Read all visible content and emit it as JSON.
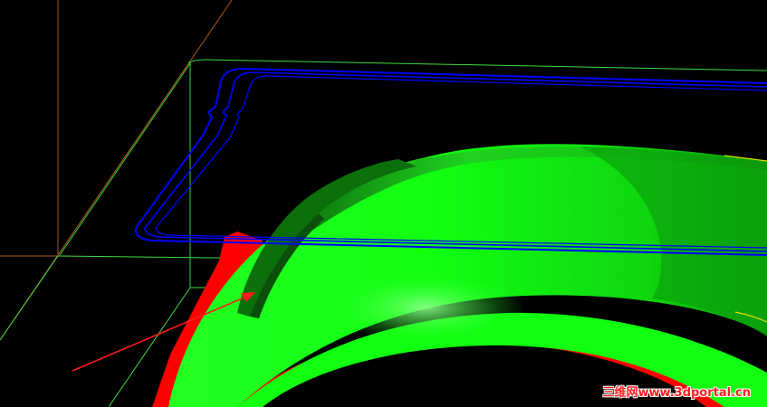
{
  "watermark": {
    "text": "三维网www.3dportal.cn"
  },
  "colors": {
    "background": "#000000",
    "surface_green": "#11ff11",
    "surface_dark_green": "#0c8a0c",
    "surface_red": "#ff0000",
    "toolpath_blue": "#0000ff",
    "wireframe_green": "#33dd33",
    "axis_orange": "#b05a1a",
    "arrow_red": "#ff1a1a",
    "watermark": "#ff2020"
  },
  "icons": {
    "pointer_arrow": "red-arrow-icon"
  }
}
